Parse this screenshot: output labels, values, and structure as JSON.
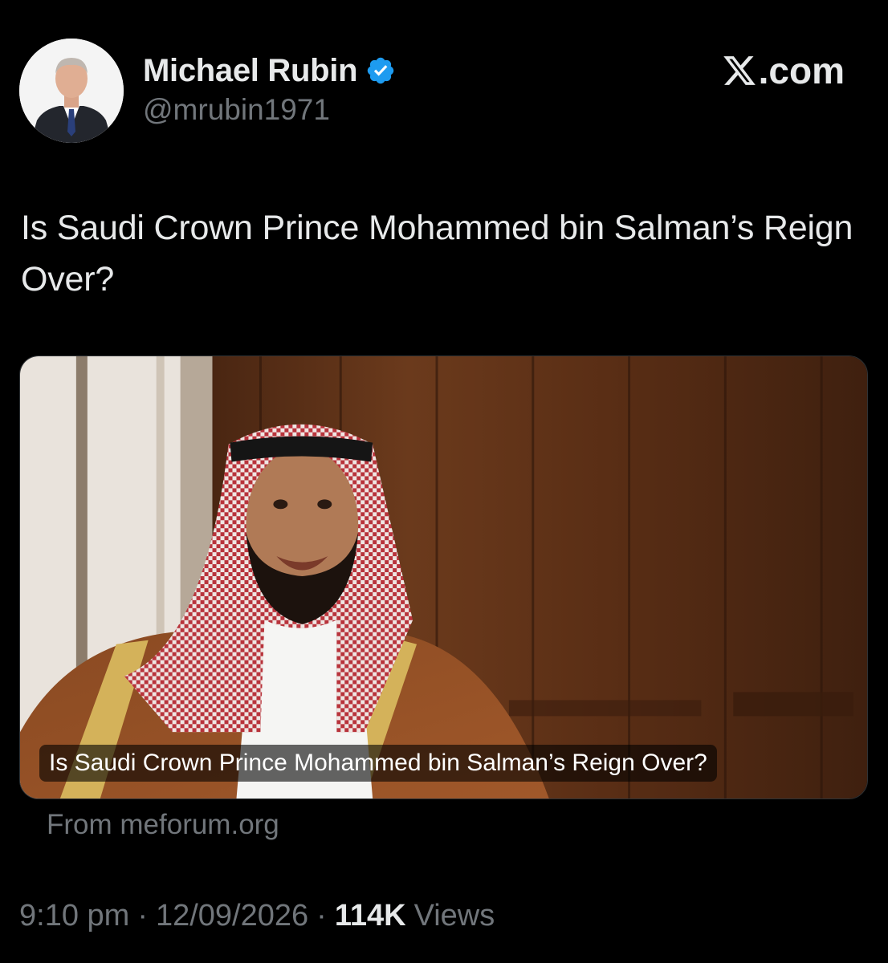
{
  "author": {
    "name": "Michael Rubin",
    "handle": "@mrubin1971",
    "verified": true,
    "verified_color": "#1d9bf0",
    "avatar_icon": "profile-photo"
  },
  "brand": {
    "logo_icon": "x-logo-icon",
    "suffix": ".com"
  },
  "tweet": {
    "text": "Is Saudi Crown Prince Mohammed bin Salman’s Reign Over?"
  },
  "link_card": {
    "title": "Is Saudi Crown Prince Mohammed bin Salman’s Reign Over?",
    "source": "From meforum.org"
  },
  "meta": {
    "time": "9:10 pm",
    "separator": "·",
    "date": "12/09/2026",
    "views_count": "114K",
    "views_label": "Views"
  },
  "colors": {
    "background": "#000000",
    "primary_text": "#e7e9ea",
    "secondary_text": "#71767b"
  }
}
